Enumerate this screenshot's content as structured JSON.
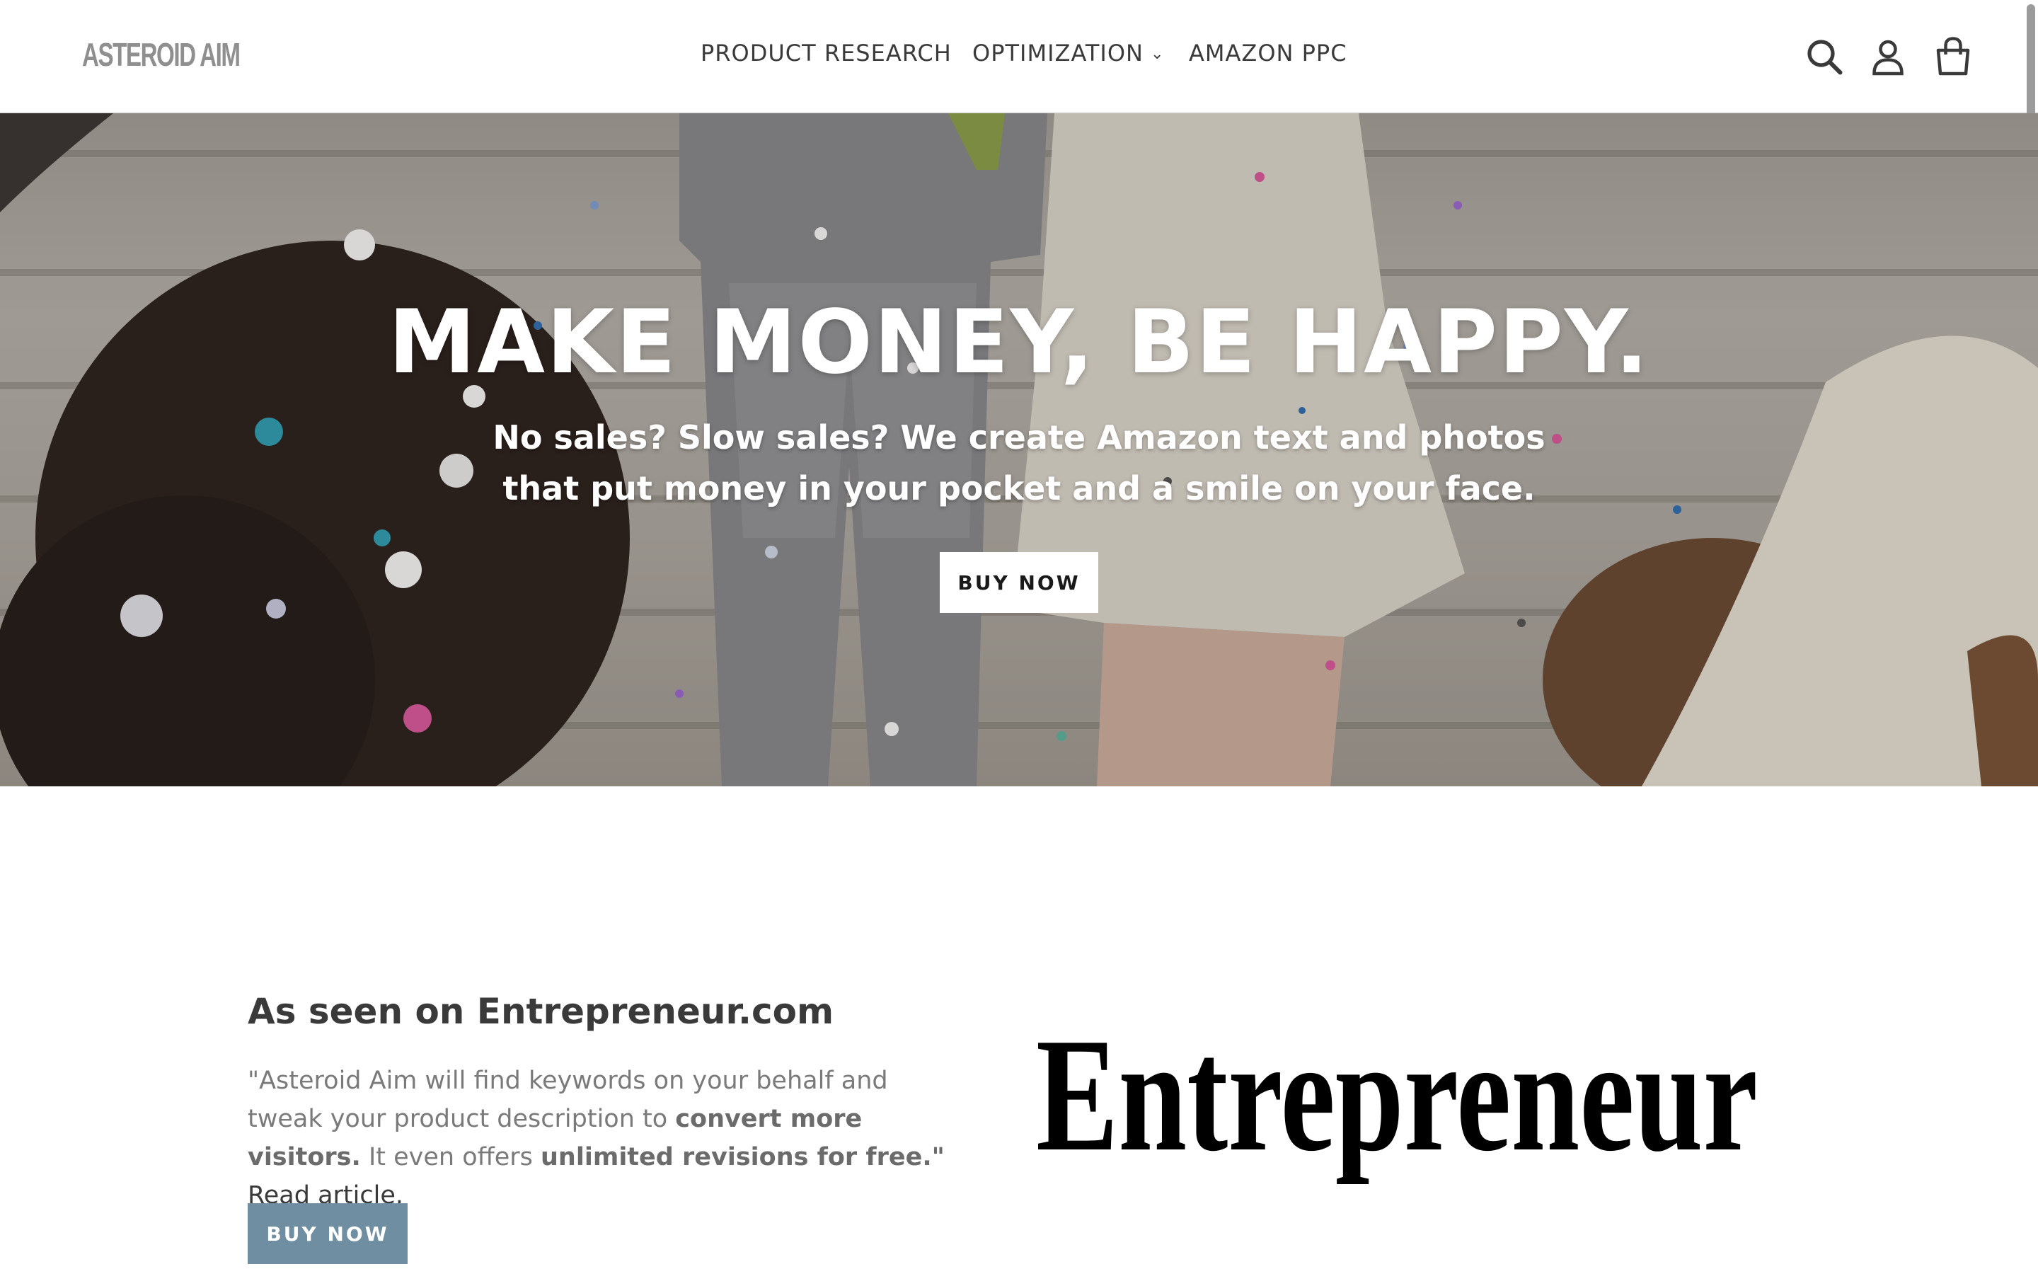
{
  "header": {
    "logo_text": "ASTEROID AIM",
    "nav": [
      {
        "label": "PRODUCT RESEARCH"
      },
      {
        "label": "OPTIMIZATION",
        "has_dropdown": true
      },
      {
        "label": "AMAZON PPC"
      }
    ],
    "icons": [
      "search-icon",
      "account-icon",
      "cart-icon"
    ]
  },
  "hero": {
    "title": "MAKE MONEY, BE HAPPY.",
    "subtitle": "No sales? Slow sales? We create Amazon text and photos that put money in your pocket and a smile on your face.",
    "button_label": "BUY NOW"
  },
  "featured": {
    "heading": "As seen on Entrepreneur.com",
    "quote_part1": "\"Asteroid Aim will find keywords on your behalf and tweak your product description to ",
    "quote_bold1": "convert more visitors.",
    "quote_part2": " It even offers ",
    "quote_bold2": "unlimited revisions for free.\"",
    "link_text": "Read article.",
    "button_label": "BUY NOW",
    "logo_text": "Entrepreneur"
  },
  "colors": {
    "accent_button": "#6f8ea2",
    "text_dark": "#3a3a3a",
    "text_muted": "#7a7a7a"
  }
}
